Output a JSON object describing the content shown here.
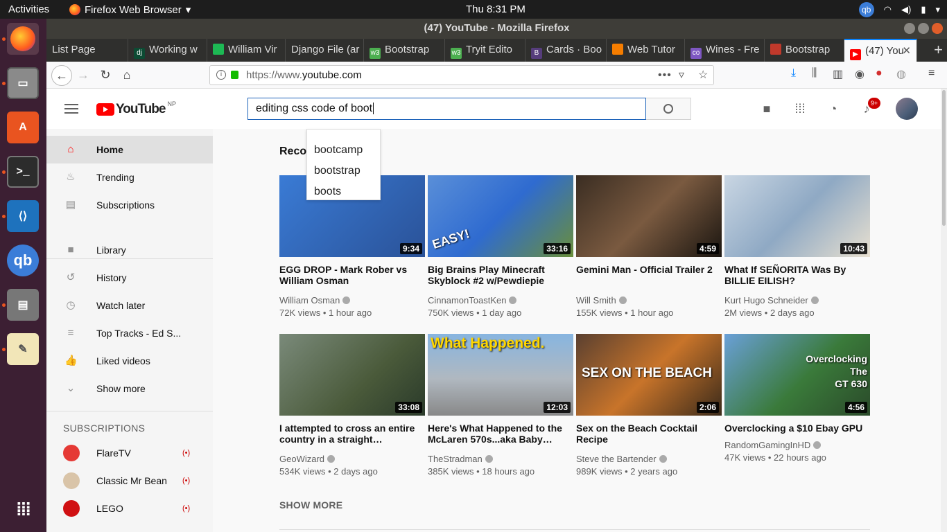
{
  "system": {
    "activities": "Activities",
    "app_name": "Firefox Web Browser",
    "app_menu_arrow": "▾",
    "clock": "Thu  8:31 PM",
    "tray_qb": "qb"
  },
  "window": {
    "title": "(47) YouTube - Mozilla Firefox"
  },
  "tabs": [
    {
      "label": "List Page",
      "icon": "",
      "color": ""
    },
    {
      "label": "Working w",
      "icon": "dj",
      "color": "#0c4b33"
    },
    {
      "label": "William Vir",
      "icon": "",
      "color": "#1db954"
    },
    {
      "label": "Django File (ar",
      "icon": "",
      "color": ""
    },
    {
      "label": "Bootstrap",
      "icon": "w3",
      "color": "#4caf50"
    },
    {
      "label": "Tryit Edito",
      "icon": "w3",
      "color": "#4caf50"
    },
    {
      "label": "Cards · Boo",
      "icon": "B",
      "color": "#563d7c"
    },
    {
      "label": "Web Tutor",
      "icon": "",
      "color": "#f57d00"
    },
    {
      "label": "Wines - Fre",
      "icon": "co",
      "color": "#7e57c2"
    },
    {
      "label": "Bootstrap",
      "icon": "",
      "color": "#c0392b"
    },
    {
      "label": "(47) You",
      "icon": "▶",
      "color": "#ff0000"
    }
  ],
  "tab_close": "✕",
  "new_tab": "+",
  "nav": {
    "url_prefix": "https://www.",
    "url_domain": "youtube.com",
    "url_suffix": "",
    "page_actions": "•••"
  },
  "youtube": {
    "logo_text": "YouTube",
    "logo_region": "NP",
    "search_value": "editing css code of boot",
    "notification_count": "9+",
    "suggestions": [
      "bootcamp",
      "bootstrap",
      "boots"
    ],
    "guide": [
      {
        "label": "Home",
        "icon": "home-icon",
        "glyph": "⌂"
      },
      {
        "label": "Trending",
        "icon": "flame-icon",
        "glyph": "♨"
      },
      {
        "label": "Subscriptions",
        "icon": "subscriptions-icon",
        "glyph": "▤"
      },
      {
        "label": "Library",
        "icon": "folder-icon",
        "glyph": "■"
      },
      {
        "label": "History",
        "icon": "history-icon",
        "glyph": "↺"
      },
      {
        "label": "Watch later",
        "icon": "clock-icon",
        "glyph": "◷"
      },
      {
        "label": "Top Tracks - Ed S...",
        "icon": "playlist-icon",
        "glyph": "≡"
      },
      {
        "label": "Liked videos",
        "icon": "thumbs-up-icon",
        "glyph": "👍"
      },
      {
        "label": "Show more",
        "icon": "chevron-down-icon",
        "glyph": "⌄"
      }
    ],
    "subscriptions_heading": "SUBSCRIPTIONS",
    "subscriptions": [
      {
        "name": "FlareTV",
        "live": "(•)",
        "color": "#e53935"
      },
      {
        "name": "Classic Mr Bean",
        "live": "(•)",
        "color": "#d9c4a8"
      },
      {
        "name": "LEGO",
        "live": "(•)",
        "color": "#d01012"
      }
    ],
    "recommended_heading": "Recommended",
    "videos": [
      {
        "title": "EGG DROP - Mark Rober vs William Osman",
        "channel": "William Osman",
        "meta": "72K views • 1 hour ago",
        "duration": "9:34",
        "bg": "linear-gradient(135deg,#3a7bd5,#2a5298)"
      },
      {
        "title": "Big Brains Play Minecraft Skyblock #2 w/Pewdiepie",
        "channel": "CinnamonToastKen",
        "meta": "750K views • 1 day ago",
        "duration": "33:16",
        "bg": "linear-gradient(135deg,#5a8fd8,#2f6bd0 50%,#6a8f3a)"
      },
      {
        "title": "Gemini Man - Official Trailer 2",
        "channel": "Will Smith",
        "meta": "155K views • 1 hour ago",
        "duration": "4:59",
        "bg": "linear-gradient(135deg,#3a2d22,#7a5a40 50%,#1a1510)"
      },
      {
        "title": "What If SEÑORITA Was By BILLIE EILISH?",
        "channel": "Kurt Hugo Schneider",
        "meta": "2M views • 2 days ago",
        "duration": "10:43",
        "bg": "linear-gradient(135deg,#c9d6e3,#8fa9c4 50%,#e8e0d0)"
      },
      {
        "title": "I attempted to cross an entire country in a straight…",
        "channel": "GeoWizard",
        "meta": "534K views • 2 days ago",
        "duration": "33:08",
        "bg": "linear-gradient(135deg,#7a8a7a,#4a5a3a 60%,#2a3a2a)"
      },
      {
        "title": "Here's What Happened to the McLaren 570s...aka Baby…",
        "channel": "TheStradman",
        "meta": "385K views • 18 hours ago",
        "duration": "12:03",
        "bg": "linear-gradient(180deg,#87b5e0,#b0b8c0 55%,#888 100%)"
      },
      {
        "title": "Sex on the Beach Cocktail Recipe",
        "channel": "Steve the Bartender",
        "meta": "989K views • 2 years ago",
        "duration": "2:06",
        "bg": "linear-gradient(135deg,#5a4030,#c8742a 50%,#3a2a1a)"
      },
      {
        "title": "Overclocking a $10 Ebay GPU",
        "channel": "RandomGamingInHD",
        "meta": "47K views • 22 hours ago",
        "duration": "4:56",
        "bg": "linear-gradient(135deg,#6aa0d8,#3a7a3a 55%,#2a4a2a)"
      }
    ],
    "thumb_overlays": {
      "v2": "EASY!",
      "v6": "What Happened.",
      "v7": "SEX ON THE BEACH",
      "v8_line1": "Overclocking",
      "v8_line2": "The",
      "v8_line3": "GT 630"
    },
    "show_more": "SHOW MORE"
  }
}
